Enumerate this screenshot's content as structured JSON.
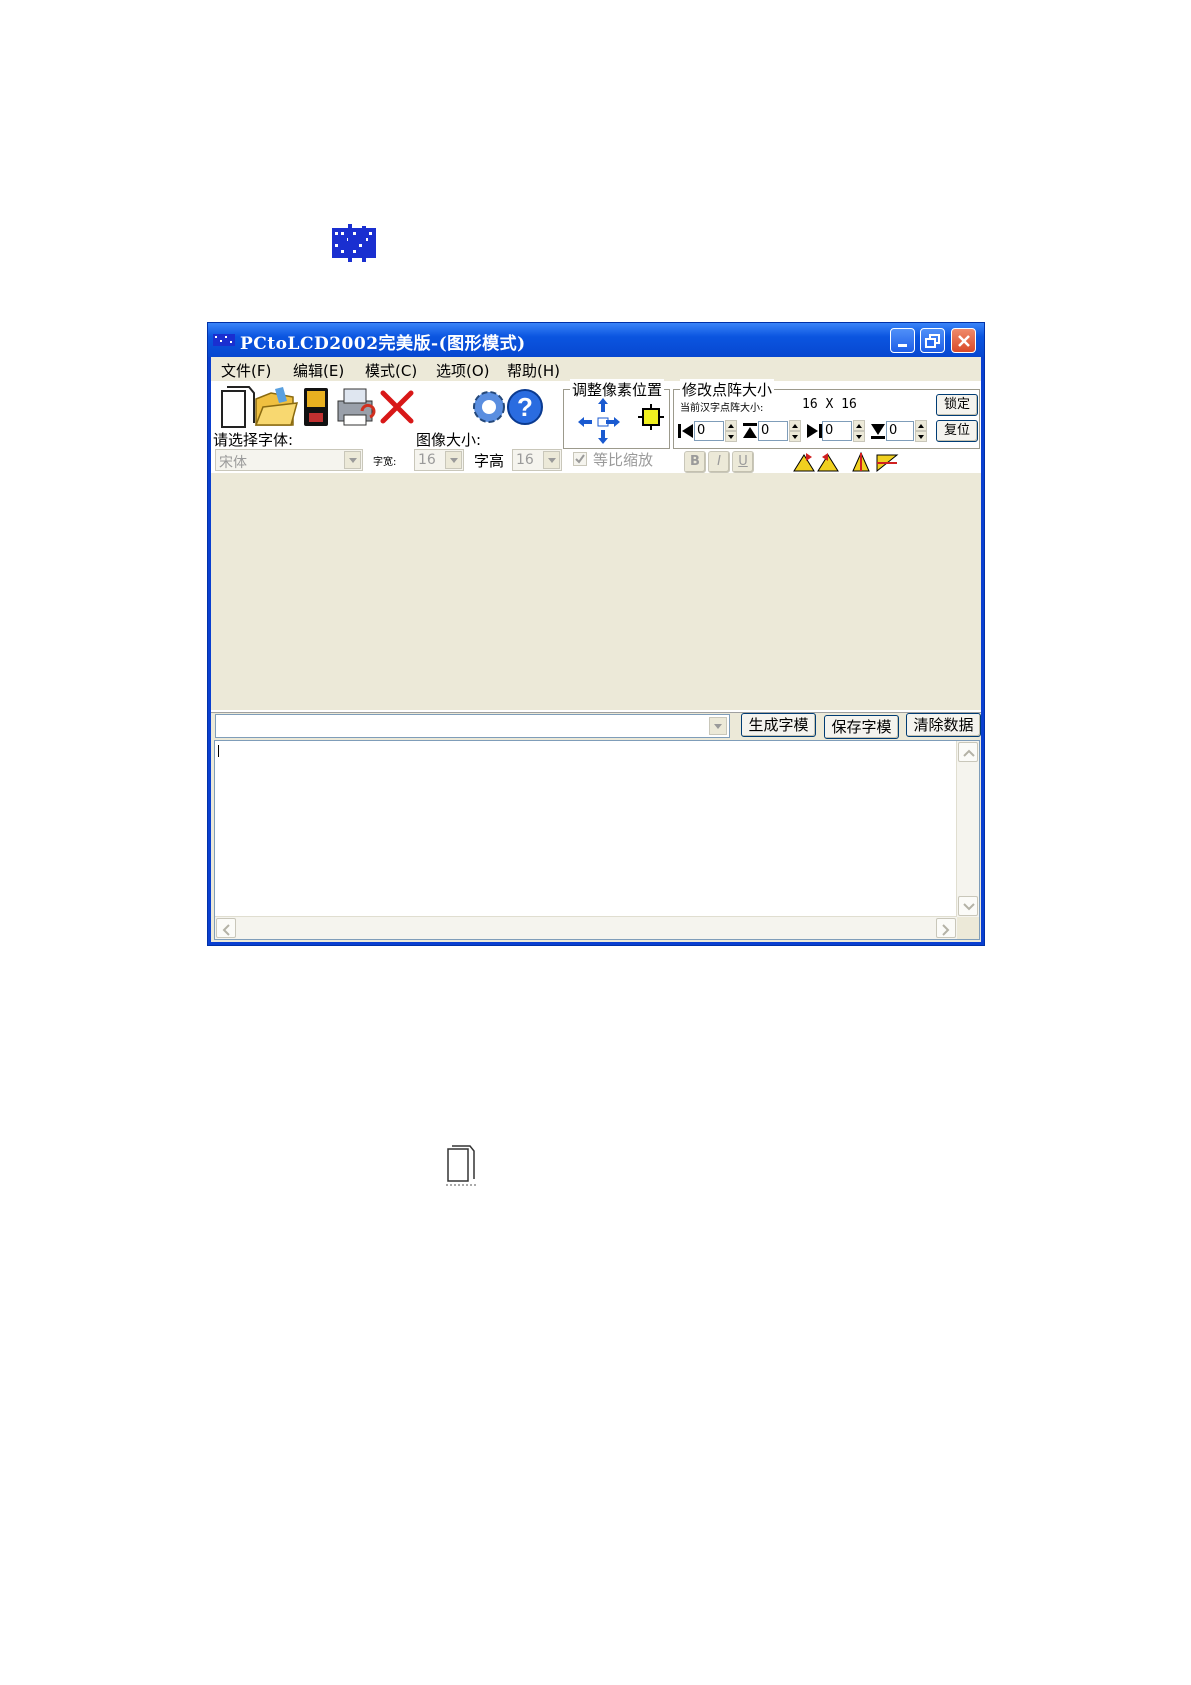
{
  "window": {
    "title": "PCtoLCD2002完美版-(图形模式)"
  },
  "menu": [
    {
      "label": "文件(F)"
    },
    {
      "label": "编辑(E)"
    },
    {
      "label": "模式(C)"
    },
    {
      "label": "选项(O)"
    },
    {
      "label": "帮助(H)"
    }
  ],
  "toolbar": {
    "icons": [
      "new-file-icon",
      "open-file-icon",
      "save-icon",
      "print-icon",
      "delete-icon",
      "settings-icon",
      "help-icon"
    ],
    "pixel_position_group": {
      "title": "调整像素位置"
    },
    "matrix_size_group": {
      "title": "修改点阵大小",
      "current_label": "当前汉字点阵大小:",
      "current_value": "16 X 16",
      "lock_button": "锁定",
      "reset_button": "复位",
      "spin_values": [
        "0",
        "0",
        "0",
        "0"
      ]
    },
    "font": {
      "label": "请选择字体:",
      "value": "宋体"
    },
    "image_size": {
      "label": "图像大小:",
      "width_label": "字宽:",
      "width_value": "16",
      "height_label": "字高",
      "height_value": "16",
      "proportional_label": "等比缩放"
    },
    "style_buttons": [
      "B",
      "I",
      "U"
    ]
  },
  "bottom": {
    "input_value": "",
    "generate_button": "生成字模",
    "save_button": "保存字模",
    "clear_button": "清除数据",
    "output_text": ""
  },
  "colors": {
    "titlebar": "#0b55e0",
    "face": "#ece9d8",
    "close": "#d94a2a"
  }
}
